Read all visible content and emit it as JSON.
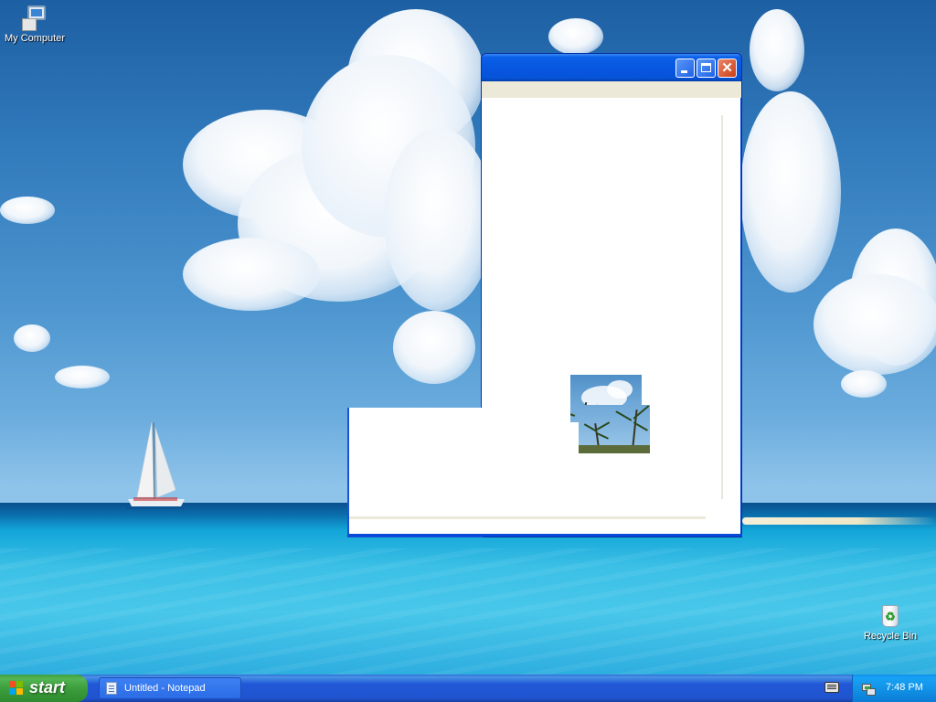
{
  "desktop": {
    "icons": [
      {
        "label": "My Computer",
        "icon": "my-computer-icon"
      },
      {
        "label": "Recycle Bin",
        "icon": "recycle-bin-icon"
      }
    ]
  },
  "window": {
    "title": "",
    "controls": {
      "minimize": "minimize-icon",
      "maximize": "maximize-icon",
      "close": "close-icon"
    },
    "menu": [],
    "text_content": ""
  },
  "taskbar": {
    "start_label": "start",
    "tasks": [
      {
        "label": "Untitled - Notepad",
        "icon": "notepad-icon"
      }
    ],
    "clock": "7:48 PM"
  },
  "colors": {
    "taskbar_blue": "#2157d7",
    "start_green": "#3c9e3c",
    "title_blue": "#0857e0",
    "close_red": "#cd3d17"
  }
}
